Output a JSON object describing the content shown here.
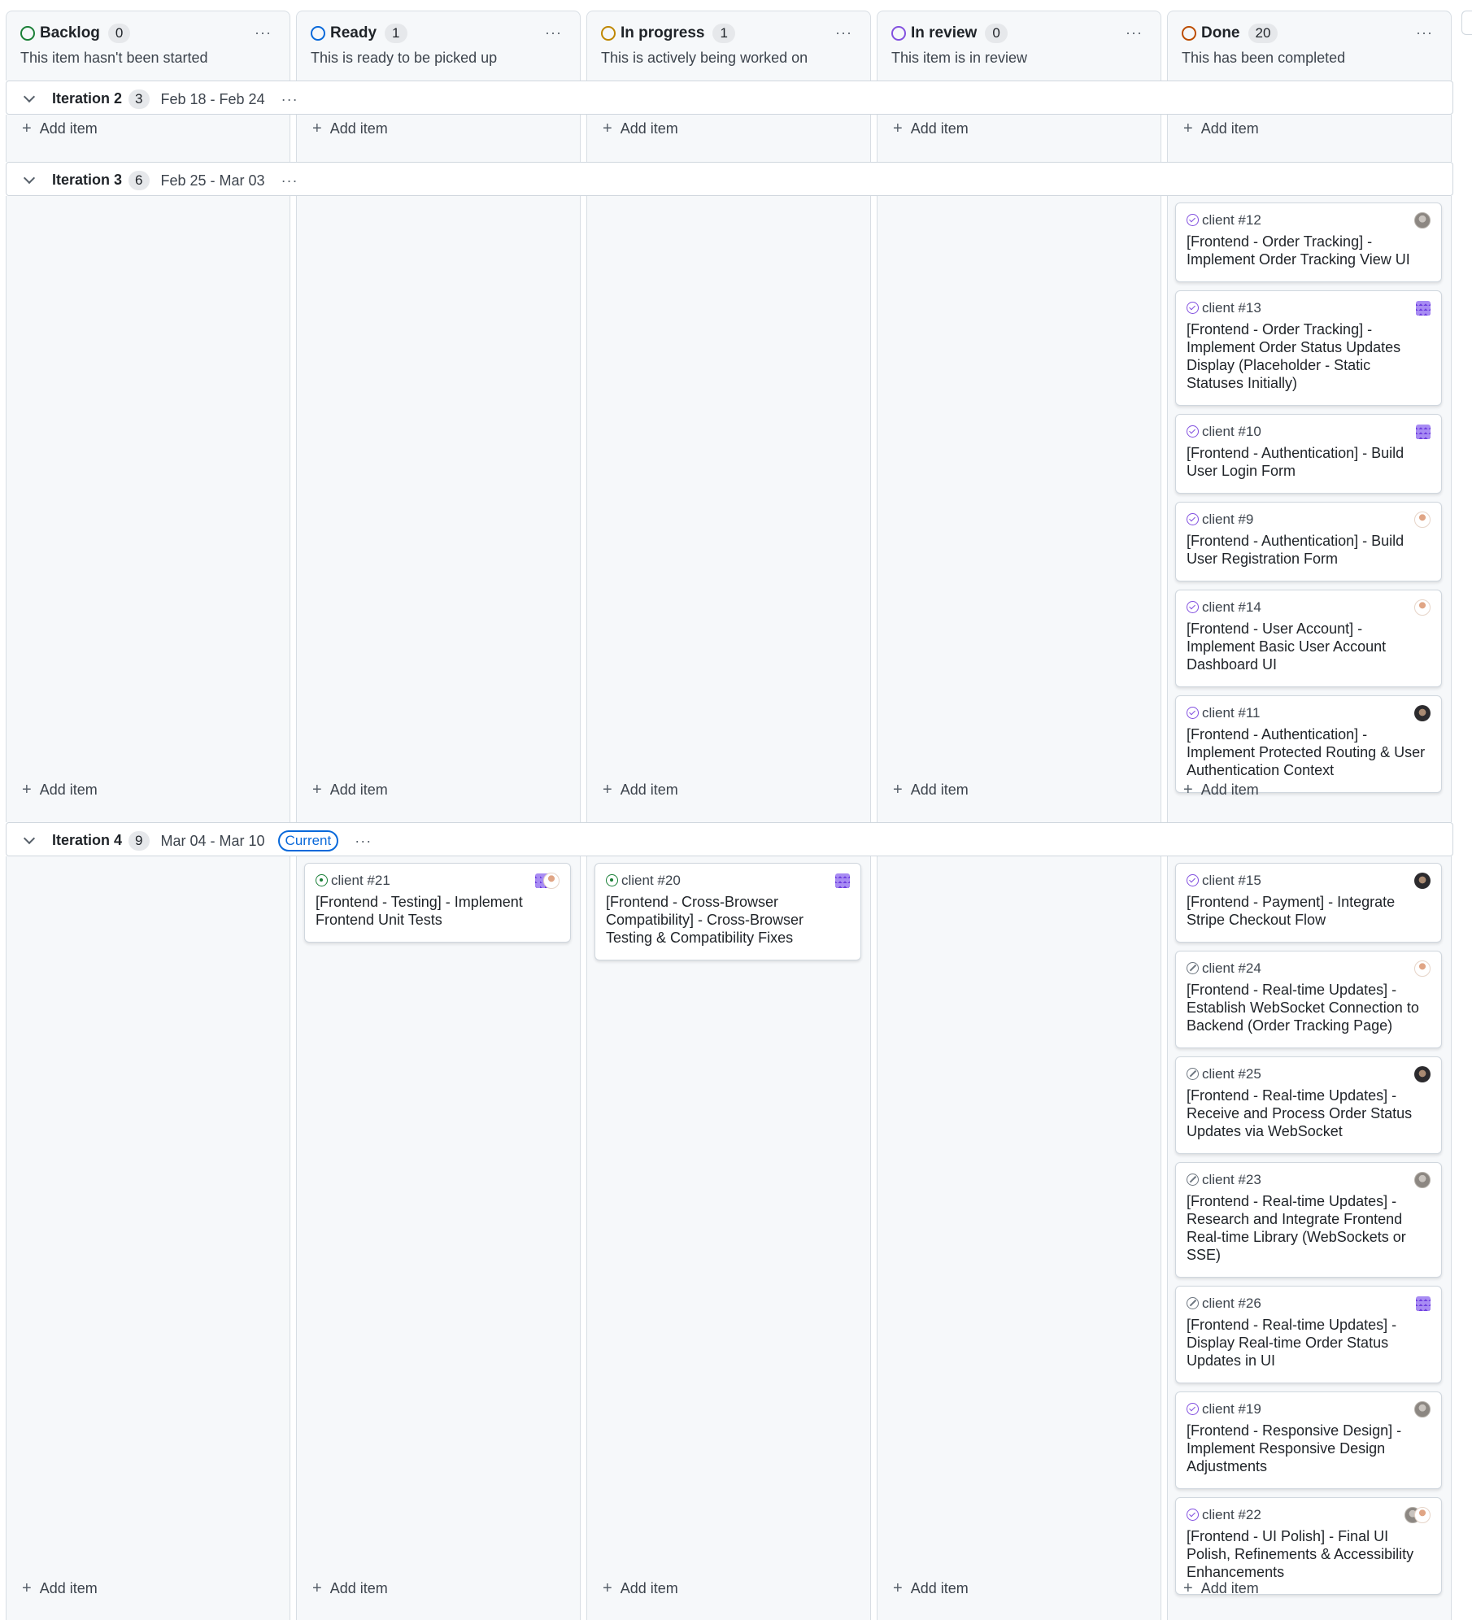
{
  "columns": [
    {
      "id": "backlog",
      "name": "Backlog",
      "count": "0",
      "description": "This item hasn't been started",
      "color": "#1a7f37"
    },
    {
      "id": "ready",
      "name": "Ready",
      "count": "1",
      "description": "This is ready to be picked up",
      "color": "#0969da"
    },
    {
      "id": "in-progress",
      "name": "In progress",
      "count": "1",
      "description": "This is actively being worked on",
      "color": "#bf8700"
    },
    {
      "id": "in-review",
      "name": "In review",
      "count": "0",
      "description": "This item is in review",
      "color": "#8250df"
    },
    {
      "id": "done",
      "name": "Done",
      "count": "20",
      "description": "This has been completed",
      "color": "#bc4c00"
    }
  ],
  "menu_glyph": "···",
  "add_item_label": "Add item",
  "groups": [
    {
      "title": "Iteration 2",
      "count": "3",
      "dates": "Feb 18 - Feb 24",
      "current": false,
      "cards": [
        [],
        [],
        [],
        [],
        []
      ]
    },
    {
      "title": "Iteration 3",
      "count": "6",
      "dates": "Feb 25 - Mar 03",
      "current": false,
      "cards": [
        [],
        [],
        [],
        [],
        [
          {
            "ref": "client #12",
            "title": "[Frontend - Order Tracking] - Implement Order Tracking View UI",
            "state": "done",
            "avatar": "gray"
          },
          {
            "ref": "client #13",
            "title": "[Frontend - Order Tracking] - Implement Order Status Updates Display (Placeholder - Static Statuses Initially)",
            "state": "done",
            "avatar": "ident"
          },
          {
            "ref": "client #10",
            "title": "[Frontend - Authentication] - Build User Login Form",
            "state": "done",
            "avatar": "ident"
          },
          {
            "ref": "client #9",
            "title": "[Frontend - Authentication] - Build User Registration Form",
            "state": "done",
            "avatar": "face"
          },
          {
            "ref": "client #14",
            "title": "[Frontend - User Account] - Implement Basic User Account Dashboard UI",
            "state": "done",
            "avatar": "face"
          },
          {
            "ref": "client #11",
            "title": "[Frontend - Authentication] - Implement Protected Routing & User Authentication Context",
            "state": "done",
            "avatar": "dark"
          }
        ]
      ]
    },
    {
      "title": "Iteration 4",
      "count": "9",
      "dates": "Mar 04 - Mar 10",
      "current": true,
      "current_label": "Current",
      "cards": [
        [],
        [
          {
            "ref": "client #21",
            "title": "[Frontend - Testing] - Implement Frontend Unit Tests",
            "state": "open",
            "avatar": "ident+face"
          }
        ],
        [
          {
            "ref": "client #20",
            "title": "[Frontend - Cross-Browser Compatibility] - Cross-Browser Testing & Compatibility Fixes",
            "state": "open",
            "avatar": "ident"
          }
        ],
        [],
        [
          {
            "ref": "client #15",
            "title": "[Frontend - Payment] - Integrate Stripe Checkout Flow",
            "state": "done",
            "avatar": "dark"
          },
          {
            "ref": "client #24",
            "title": "[Frontend - Real-time Updates] - Establish WebSocket Connection to Backend (Order Tracking Page)",
            "state": "closed",
            "avatar": "face"
          },
          {
            "ref": "client #25",
            "title": "[Frontend - Real-time Updates] - Receive and Process Order Status Updates via WebSocket",
            "state": "closed",
            "avatar": "dark"
          },
          {
            "ref": "client #23",
            "title": "[Frontend - Real-time Updates] - Research and Integrate Frontend Real-time Library (WebSockets or SSE)",
            "state": "closed",
            "avatar": "gray"
          },
          {
            "ref": "client #26",
            "title": "[Frontend - Real-time Updates] - Display Real-time Order Status Updates in UI",
            "state": "closed",
            "avatar": "ident"
          },
          {
            "ref": "client #19",
            "title": "[Frontend - Responsive Design] - Implement Responsive Design Adjustments",
            "state": "done",
            "avatar": "gray"
          },
          {
            "ref": "client #22",
            "title": "[Frontend - UI Polish] - Final UI Polish, Refinements & Accessibility Enhancements",
            "state": "done",
            "avatar": "gray+face"
          }
        ]
      ]
    }
  ]
}
